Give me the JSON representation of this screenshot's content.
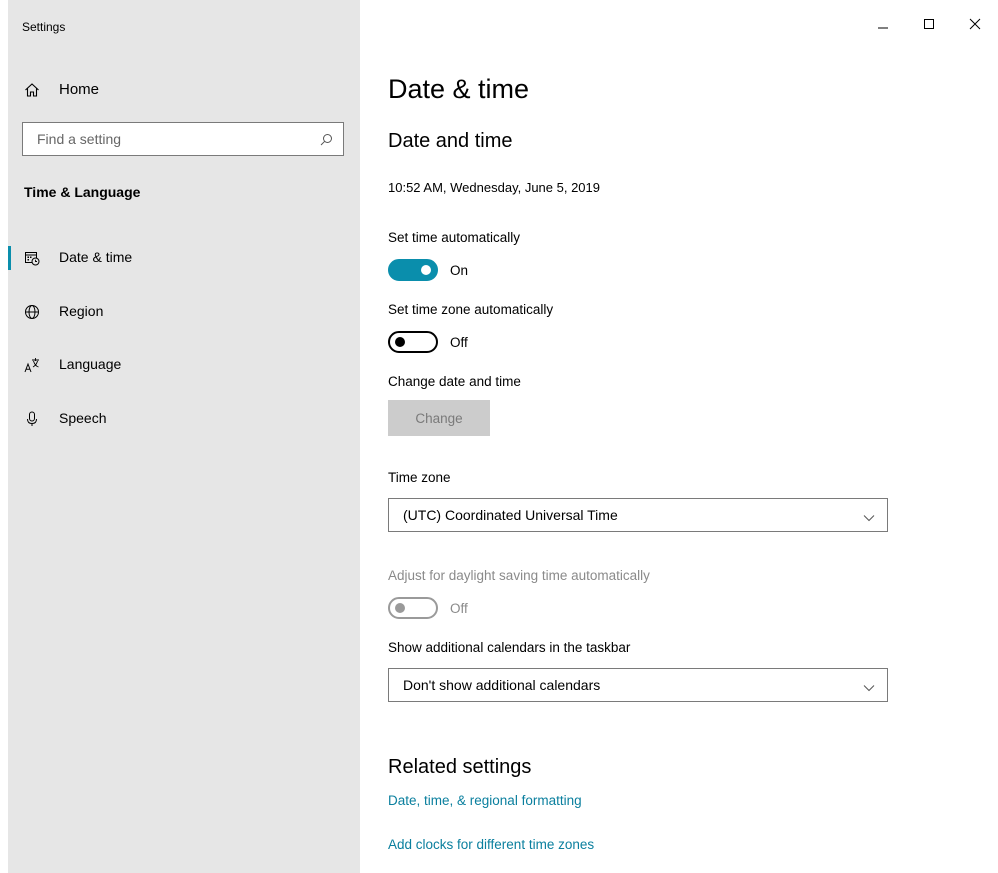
{
  "window": {
    "title": "Settings"
  },
  "sidebar": {
    "home_label": "Home",
    "search_placeholder": "Find a setting",
    "section_title": "Time & Language",
    "items": [
      {
        "label": "Date & time",
        "icon": "calendar-clock-icon",
        "selected": true
      },
      {
        "label": "Region",
        "icon": "globe-icon",
        "selected": false
      },
      {
        "label": "Language",
        "icon": "language-icon",
        "selected": false
      },
      {
        "label": "Speech",
        "icon": "microphone-icon",
        "selected": false
      }
    ]
  },
  "main": {
    "page_title": "Date & time",
    "section_title": "Date and time",
    "current_datetime": "10:52 AM, Wednesday, June 5, 2019",
    "set_time_auto": {
      "label": "Set time automatically",
      "state": "On"
    },
    "set_timezone_auto": {
      "label": "Set time zone automatically",
      "state": "Off"
    },
    "change_datetime": {
      "label": "Change date and time",
      "button": "Change"
    },
    "time_zone": {
      "label": "Time zone",
      "value": "(UTC) Coordinated Universal Time"
    },
    "daylight": {
      "label": "Adjust for daylight saving time automatically",
      "state": "Off"
    },
    "calendars": {
      "label": "Show additional calendars in the taskbar",
      "value": "Don't show additional calendars"
    },
    "related": {
      "title": "Related settings",
      "links": [
        "Date, time, & regional formatting",
        "Add clocks for different time zones"
      ]
    }
  },
  "colors": {
    "accent": "#0a8eac",
    "link": "#0a7f9e",
    "sidebar_bg": "#e6e6e6"
  }
}
